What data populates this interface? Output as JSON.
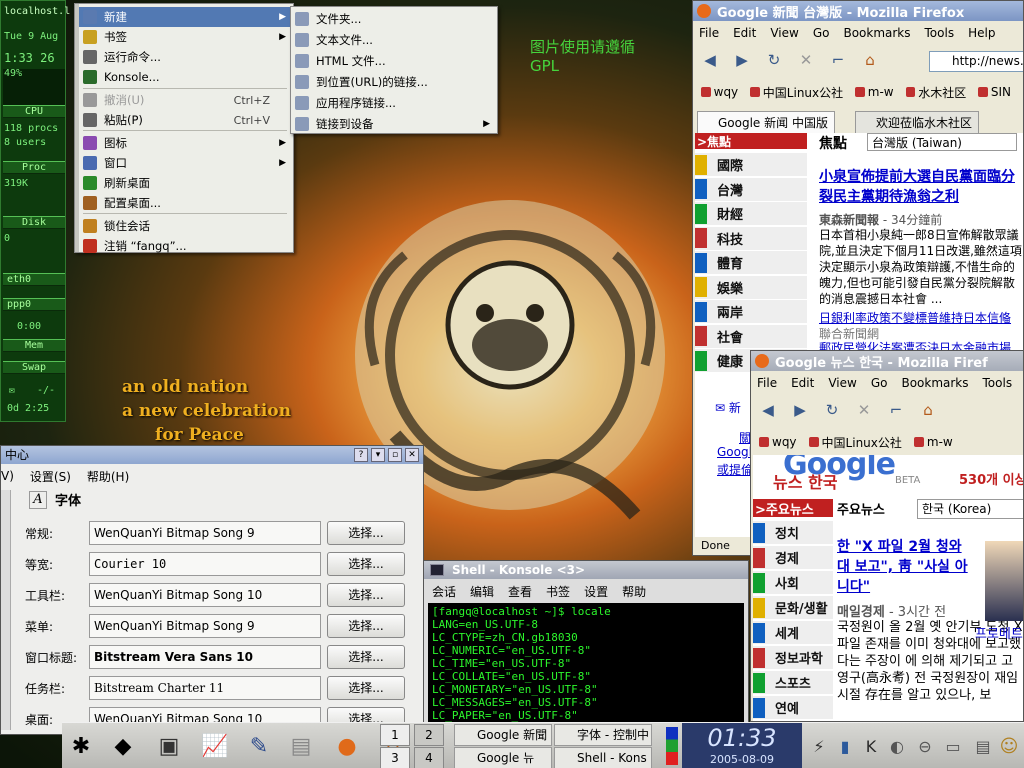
{
  "wallpaper": {
    "note_line1": "图片使用请遵循",
    "note_line2": "GPL",
    "slogan1": "an old nation",
    "slogan2": "a new celebration",
    "slogan3": "for Peace"
  },
  "gkrellm": {
    "host": "localhost.l",
    "date": "Tue  9 Aug",
    "time": "1:33 26",
    "pct": "49%",
    "cpu": "CPU",
    "procs": "118 procs",
    "users": "8 users",
    "proc": "Proc",
    "disk_val": "319K",
    "disk": "Disk",
    "disk_zero": "0",
    "eth0": "eth0",
    "ppp0": "ppp0",
    "ppp_time": "0:00",
    "mem": "Mem",
    "swap": "Swap",
    "mail": "-/-",
    "uptime": "0d  2:25"
  },
  "menu": {
    "items": [
      {
        "label": "新建",
        "hl": true,
        "arrow": true
      },
      {
        "label": "书签",
        "arrow": true
      },
      {
        "label": "运行命令..."
      },
      {
        "label": "Konsole..."
      },
      {
        "label": "撤消(U)",
        "shortcut": "Ctrl+Z",
        "disabled": true
      },
      {
        "label": "粘贴(P)",
        "shortcut": "Ctrl+V"
      },
      {
        "label": "图标",
        "arrow": true
      },
      {
        "label": "窗口",
        "arrow": true
      },
      {
        "label": "刷新桌面"
      },
      {
        "label": "配置桌面..."
      },
      {
        "label": "锁住会话"
      },
      {
        "label": "注销 “fangq”..."
      }
    ]
  },
  "submenu": {
    "items": [
      {
        "label": "文件夹..."
      },
      {
        "label": "文本文件..."
      },
      {
        "label": "HTML 文件..."
      },
      {
        "label": "到位置(URL)的链接..."
      },
      {
        "label": "应用程序链接..."
      },
      {
        "label": "链接到设备",
        "arrow": true
      }
    ]
  },
  "ff1": {
    "title": "Google 新聞 台灣版 - Mozilla Firefox",
    "menu": [
      "File",
      "Edit",
      "View",
      "Go",
      "Bookmarks",
      "Tools",
      "Help"
    ],
    "url": "http://news.",
    "bookmarks": [
      "wqy",
      "中国Linux公社",
      "m-w",
      "水木社区",
      "SIN"
    ],
    "tabs": [
      "Google 新闻 中国版",
      "欢迎莅临水木社区"
    ],
    "cat_header": ">焦點",
    "cats": [
      "國際",
      "台灣",
      "財經",
      "科技",
      "體育",
      "娛樂",
      "兩岸",
      "社會",
      "健康"
    ],
    "cat_colors": [
      "#e0b000",
      "#1060c0",
      "#10a030",
      "#c03030",
      "#1060c0",
      "#e0b000",
      "#1060c0",
      "#c03030",
      "#10a030"
    ],
    "top_label": "焦點",
    "edition": "台灣版 (Taiwan)",
    "headline": "小泉宣佈提前大選自民黨面臨分裂民主黨期待漁翁之利",
    "source": "東森新聞報",
    "source_time": "- 34分鐘前",
    "body": "日本首相小泉純一郎8日宣佈解散眾議院,並且決定下個月11日改選,雖然這項決定顯示小泉為政策辯護,不惜生命的魄力,但也可能引發自民黨分裂院解散的消息震撼日本社會 ...",
    "link2": "日銀利率政策不變標普維持日本信偹",
    "src2": "聯合新聞網",
    "link3": "郵政民營化法案遭否決日本金融市場",
    "mail": "新",
    "left1": "關",
    "left2": "Googl",
    "left3": "或提倫",
    "status": "Done"
  },
  "ff2": {
    "title": "Google 뉴스 한국 - Mozilla Firef",
    "menu": [
      "File",
      "Edit",
      "View",
      "Go",
      "Bookmarks",
      "Tools"
    ],
    "bookmarks": [
      "wqy",
      "中国Linux公社",
      "m-w"
    ],
    "logo_sub": "뉴스 한국",
    "beta": "BETA",
    "count": "530개 이상",
    "cat_header": ">주요뉴스",
    "cats": [
      "정치",
      "경제",
      "사회",
      "문화/생활",
      "세계",
      "정보과학",
      "스포츠",
      "연예"
    ],
    "cat_colors": [
      "#1060c0",
      "#c03030",
      "#10a030",
      "#e0b000",
      "#1060c0",
      "#c03030",
      "#10a030",
      "#1060c0"
    ],
    "top_label": "주요뉴스",
    "edition": "한국 (Korea)",
    "headline": "한 \"X 파일 2월 청와대 보고\", 靑 \"사실 아니다\"",
    "source": "매일경제",
    "source_time": "- 3시간 전",
    "body": "국정원이 올 2월 옛 안기부 도청 X 파일 존재를 이미 청와대에 보고했다는 주장이 에 의해 제기되고 고영구(高永耉) 전 국정원장이 재임시절 存在를 알고 있으나, 보",
    "photo_caption": "프로메트스"
  },
  "cc": {
    "title": "中心",
    "menu": [
      "V)",
      "设置(S)",
      "帮助(H)"
    ],
    "section": "字体",
    "rows": [
      {
        "label": "常规:",
        "value": "WenQuanYi Bitmap Song 9",
        "btn": "选择..."
      },
      {
        "label": "等宽:",
        "value": "Courier 10",
        "btn": "选择..."
      },
      {
        "label": "工具栏:",
        "value": "WenQuanYi Bitmap Song 10",
        "btn": "选择..."
      },
      {
        "label": "菜单:",
        "value": "WenQuanYi Bitmap Song 9",
        "btn": "选择..."
      },
      {
        "label": "窗口标题:",
        "value": "Bitstream Vera Sans 10",
        "btn": "选择..."
      },
      {
        "label": "任务栏:",
        "value": "Bitstream Charter 11",
        "btn": "选择..."
      },
      {
        "label": "桌面:",
        "value": "WenQuanYi Bitmap Song 10",
        "btn": "选择..."
      }
    ]
  },
  "konsole": {
    "title": "Shell - Konsole <3>",
    "menu": [
      "会话",
      "编辑",
      "查看",
      "书签",
      "设置",
      "帮助"
    ],
    "lines": [
      "[fangq@localhost ~]$ locale",
      "LANG=en_US.UTF-8",
      "LC_CTYPE=zh_CN.gb18030",
      "LC_NUMERIC=\"en_US.UTF-8\"",
      "LC_TIME=\"en_US.UTF-8\"",
      "LC_COLLATE=\"en_US.UTF-8\"",
      "LC_MONETARY=\"en_US.UTF-8\"",
      "LC_MESSAGES=\"en_US.UTF-8\"",
      "LC_PAPER=\"en_US.UTF-8\""
    ]
  },
  "panel": {
    "pager": [
      "1",
      "2",
      "3",
      "4"
    ],
    "tasks": [
      "Google 新聞",
      "字体 - 控制中",
      "Google 뉴",
      "Shell - Kons"
    ],
    "clock": "01:33",
    "date": "2005-08-09"
  }
}
